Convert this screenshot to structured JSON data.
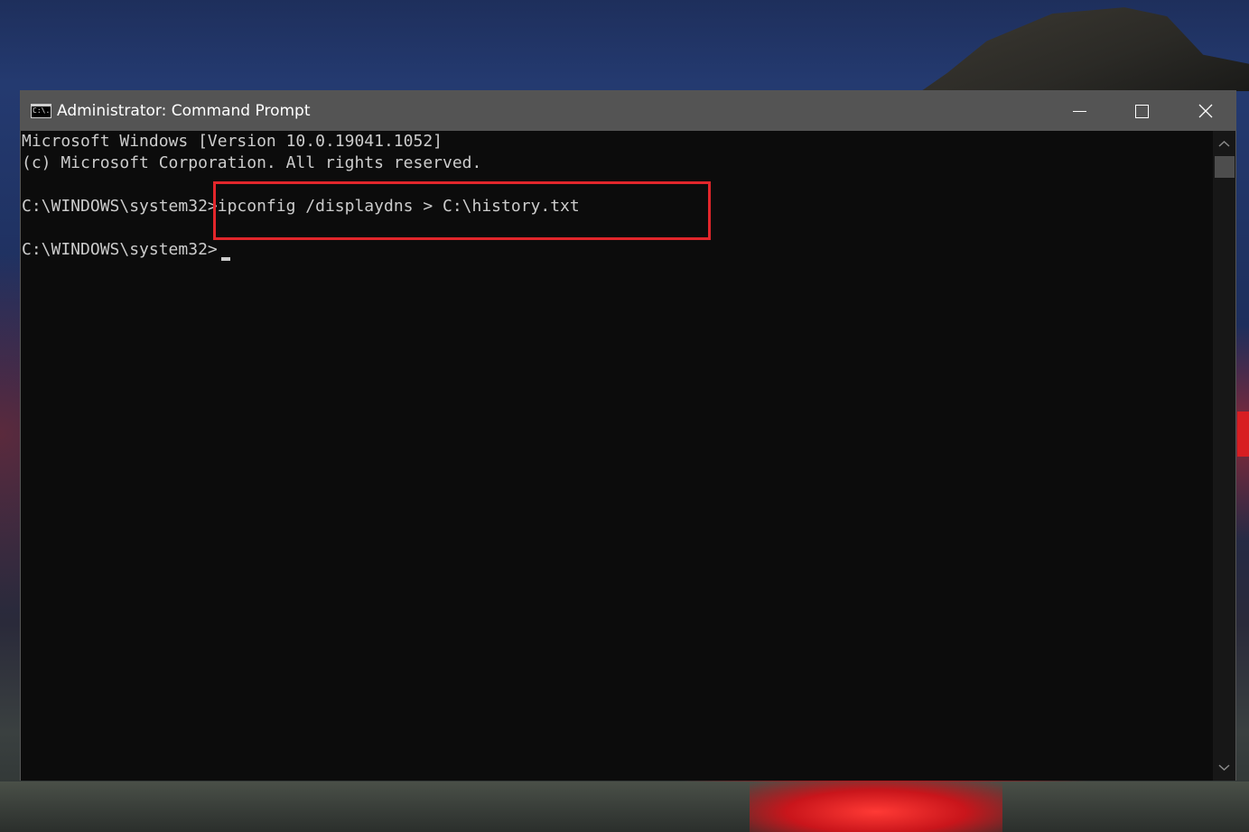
{
  "window": {
    "title": "Administrator: Command Prompt",
    "icon_label": "C:\\.",
    "controls": {
      "minimize_icon": "minimize-icon",
      "maximize_icon": "maximize-icon",
      "close_icon": "close-icon"
    }
  },
  "console": {
    "line1": "Microsoft Windows [Version 10.0.19041.1052]",
    "line2": "(c) Microsoft Corporation. All rights reserved.",
    "prompt1": "C:\\WINDOWS\\system32>",
    "command1": "ipconfig /displaydns > C:\\history.txt",
    "prompt2": "C:\\WINDOWS\\system32>"
  },
  "colors": {
    "highlight": "#e2262b",
    "console_bg": "#0c0c0c",
    "console_text": "#cccccc",
    "titlebar_bg": "#545454"
  }
}
